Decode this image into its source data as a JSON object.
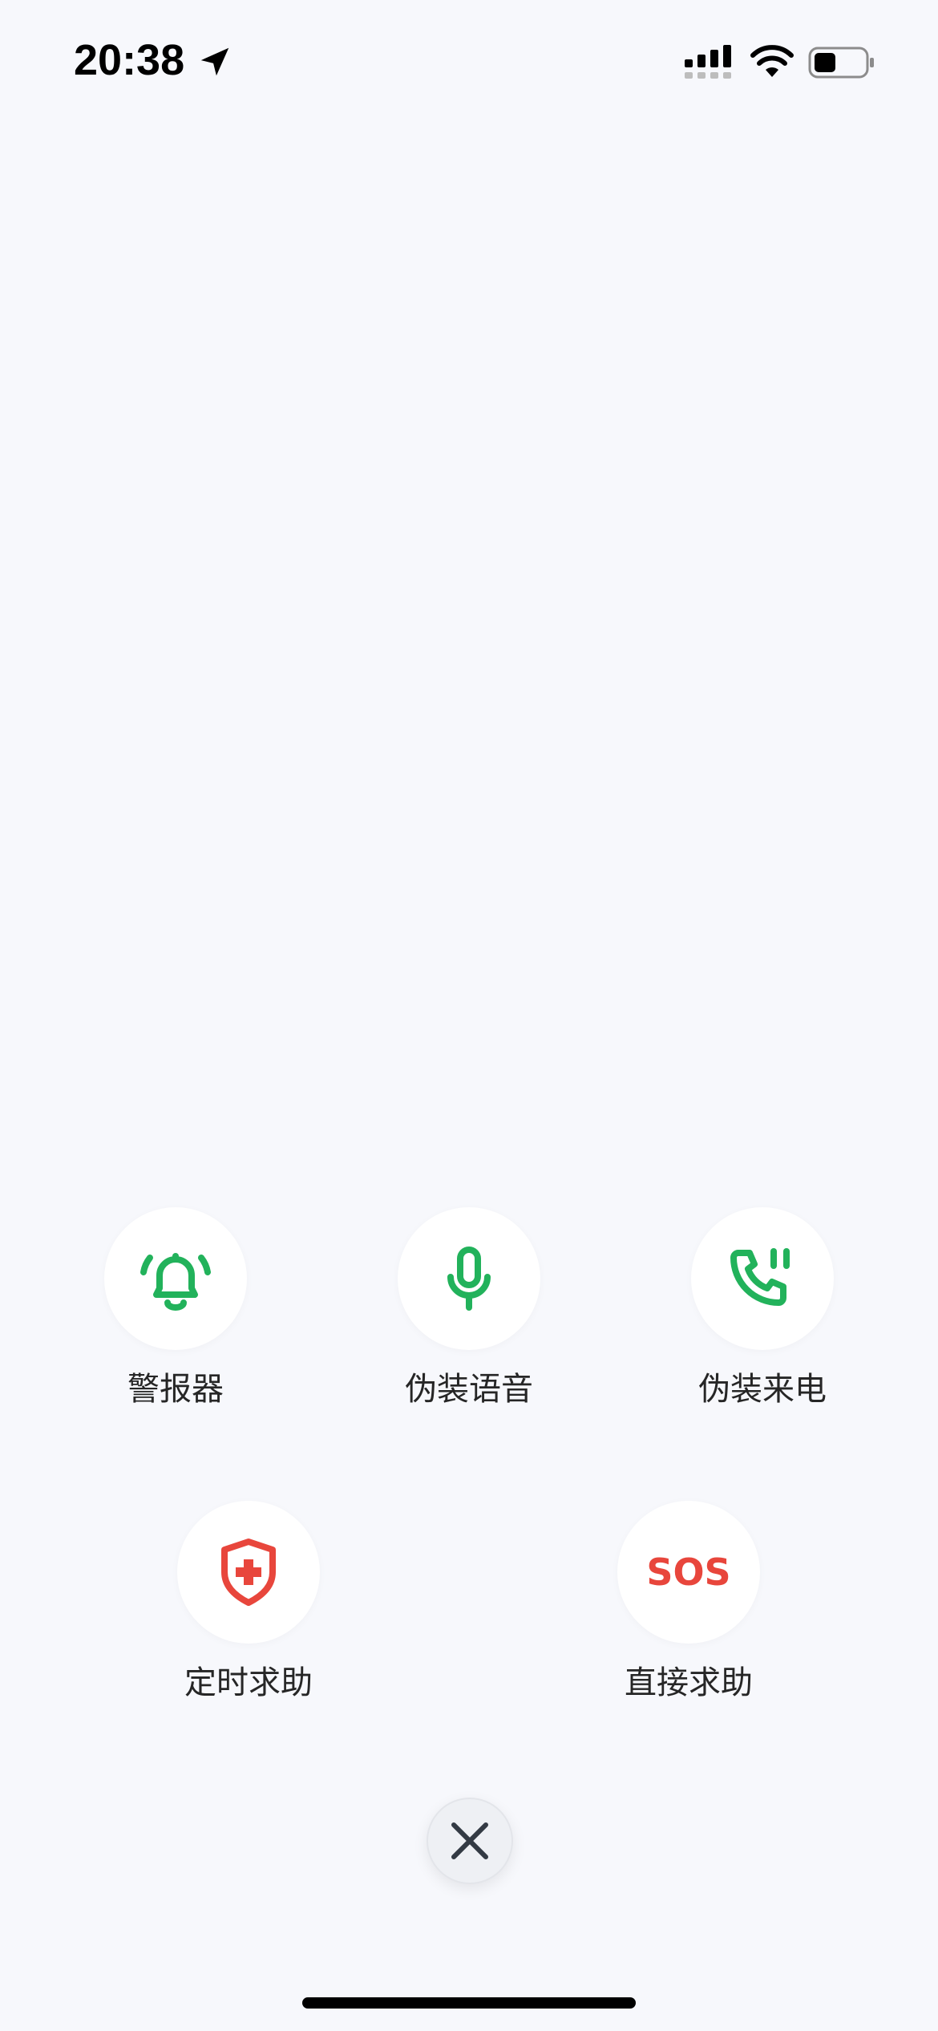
{
  "status_bar": {
    "time": "20:38",
    "icons": [
      "location-arrow-icon",
      "cellular-signal-icon",
      "wifi-icon",
      "battery-icon"
    ]
  },
  "actions": [
    {
      "label": "警报器",
      "icon": "bell-alarm-icon",
      "color": "#22b25b"
    },
    {
      "label": "伪装语音",
      "icon": "microphone-icon",
      "color": "#22b25b"
    },
    {
      "label": "伪装来电",
      "icon": "phone-call-icon",
      "color": "#22b25b"
    },
    {
      "label": "定时求助",
      "icon": "shield-medical-icon",
      "color": "#e8463c"
    },
    {
      "label": "直接求助",
      "icon": "sos-icon",
      "icon_text": "SOS",
      "color": "#e8463c"
    }
  ],
  "close_button": {
    "icon": "close-icon"
  },
  "colors": {
    "background": "#f7f8fc",
    "green": "#22b25b",
    "red": "#e8463c"
  }
}
